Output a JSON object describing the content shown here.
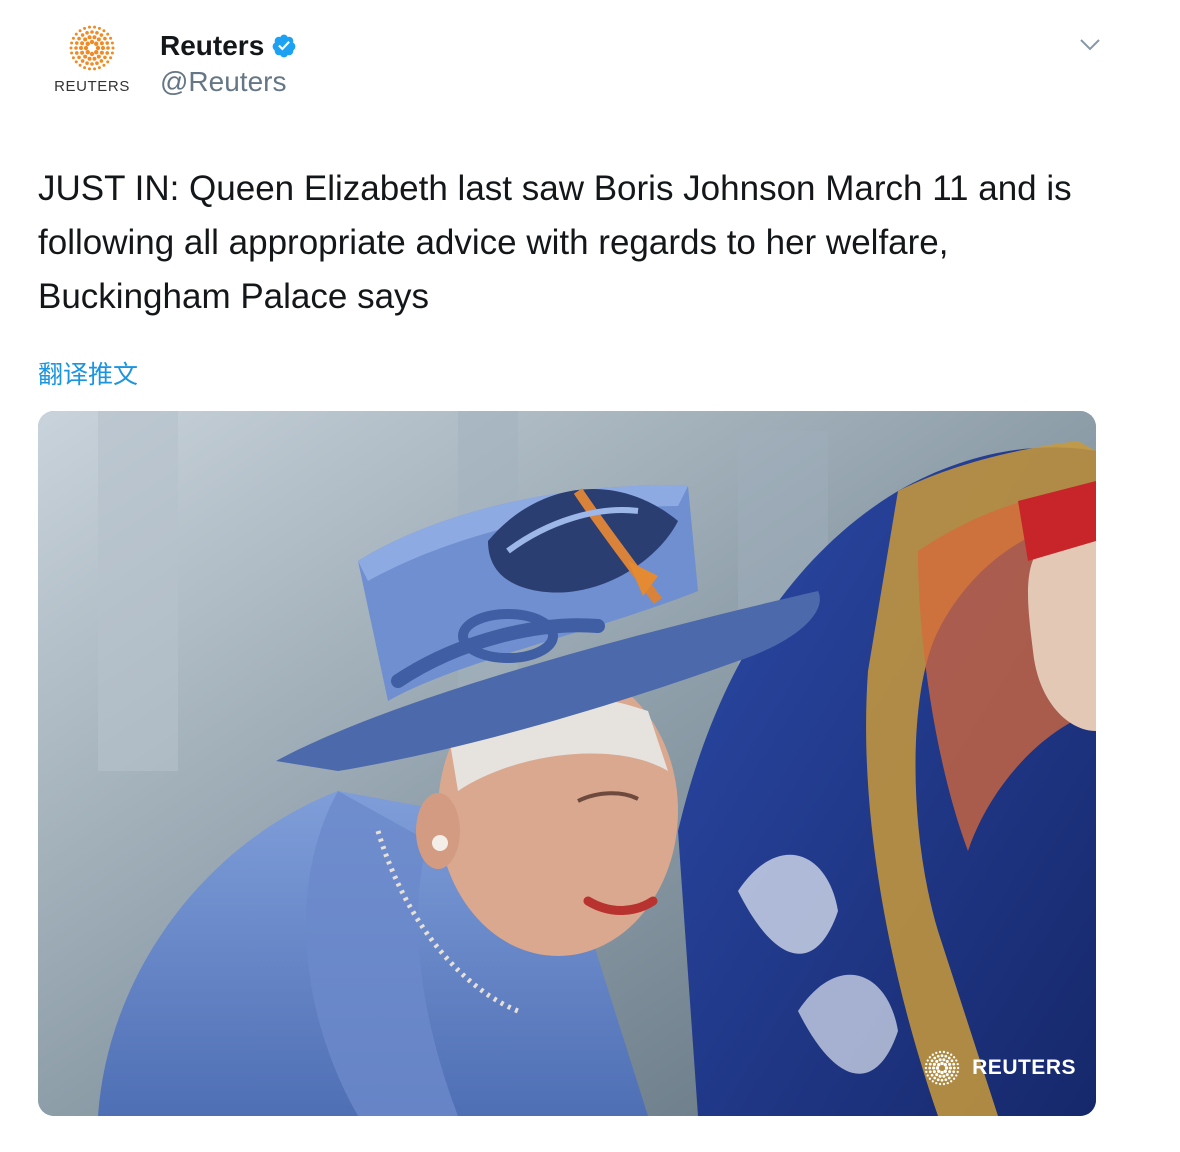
{
  "author": {
    "display_name": "Reuters",
    "handle": "@Reuters",
    "verified": true,
    "avatar_wordmark": "REUTERS",
    "avatar_icon": "reuters-dot-logo"
  },
  "tweet": {
    "text": "JUST IN: Queen Elizabeth last saw Boris Johnson March 11 and is following all appropriate advice with regards to her welfare, Buckingham Palace says",
    "translate_label": "翻译推文"
  },
  "media": {
    "watermark": "REUTERS"
  },
  "icons": {
    "more": "chevron-down-icon",
    "verified": "verified-badge-icon"
  },
  "colors": {
    "accent": "#1b95e0",
    "brand_orange": "#f08a24",
    "text": "#14171a",
    "muted": "#657786"
  }
}
